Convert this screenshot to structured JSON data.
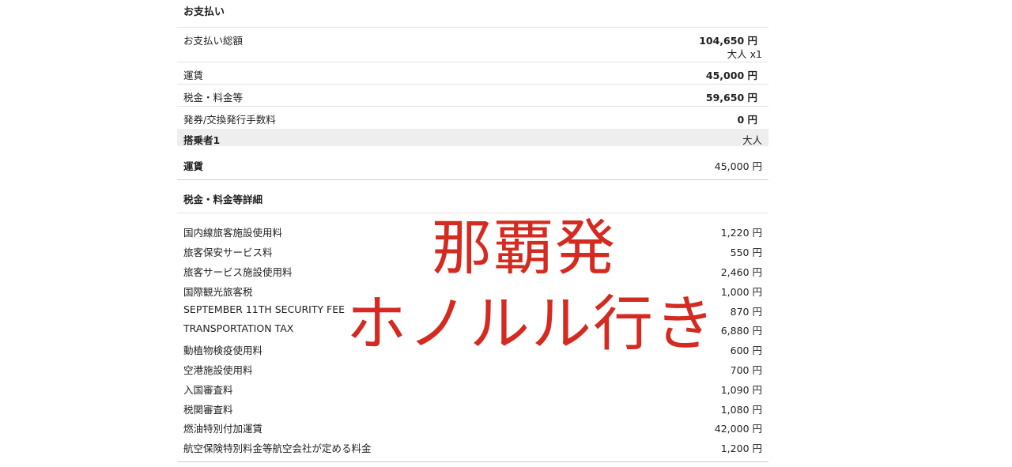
{
  "payment": {
    "title": "お支払い",
    "total": {
      "label": "お支払い総額",
      "value": "104,650 円",
      "sub": "大人 x1"
    },
    "rows": [
      {
        "label": "運賃",
        "value": "45,000 円"
      },
      {
        "label": "税金・料金等",
        "value": "59,650 円"
      },
      {
        "label": "発券/交換発行手数料",
        "value": "0 円"
      }
    ]
  },
  "passenger": {
    "label": "搭乗者1",
    "type": "大人",
    "fare_label": "運賃",
    "fare_value": "45,000 円"
  },
  "tax_detail": {
    "title": "税金・料金等詳細",
    "items": [
      {
        "label": "国内線旅客施設使用料",
        "value": "1,220 円"
      },
      {
        "label": "旅客保安サービス料",
        "value": "550 円"
      },
      {
        "label": "旅客サービス施設使用料",
        "value": "2,460 円"
      },
      {
        "label": "国際観光旅客税",
        "value": "1,000 円"
      },
      {
        "label": "SEPTEMBER 11TH SECURITY FEE",
        "value": "870 円"
      },
      {
        "label": "TRANSPORTATION TAX",
        "value": "6,880 円"
      },
      {
        "label": "動植物検疫使用料",
        "value": "600 円"
      },
      {
        "label": "空港施設使用料",
        "value": "700 円"
      },
      {
        "label": "入国審査料",
        "value": "1,090 円"
      },
      {
        "label": "税関審査料",
        "value": "1,080 円"
      },
      {
        "label": "燃油特別付加運賃",
        "value": "42,000 円"
      },
      {
        "label": "航空保険特別料金等航空会社が定める料金",
        "value": "1,200 円"
      }
    ]
  },
  "overlay": {
    "line1": "那覇発",
    "line2": "ホノルル行き",
    "color": "#d42a1f"
  }
}
